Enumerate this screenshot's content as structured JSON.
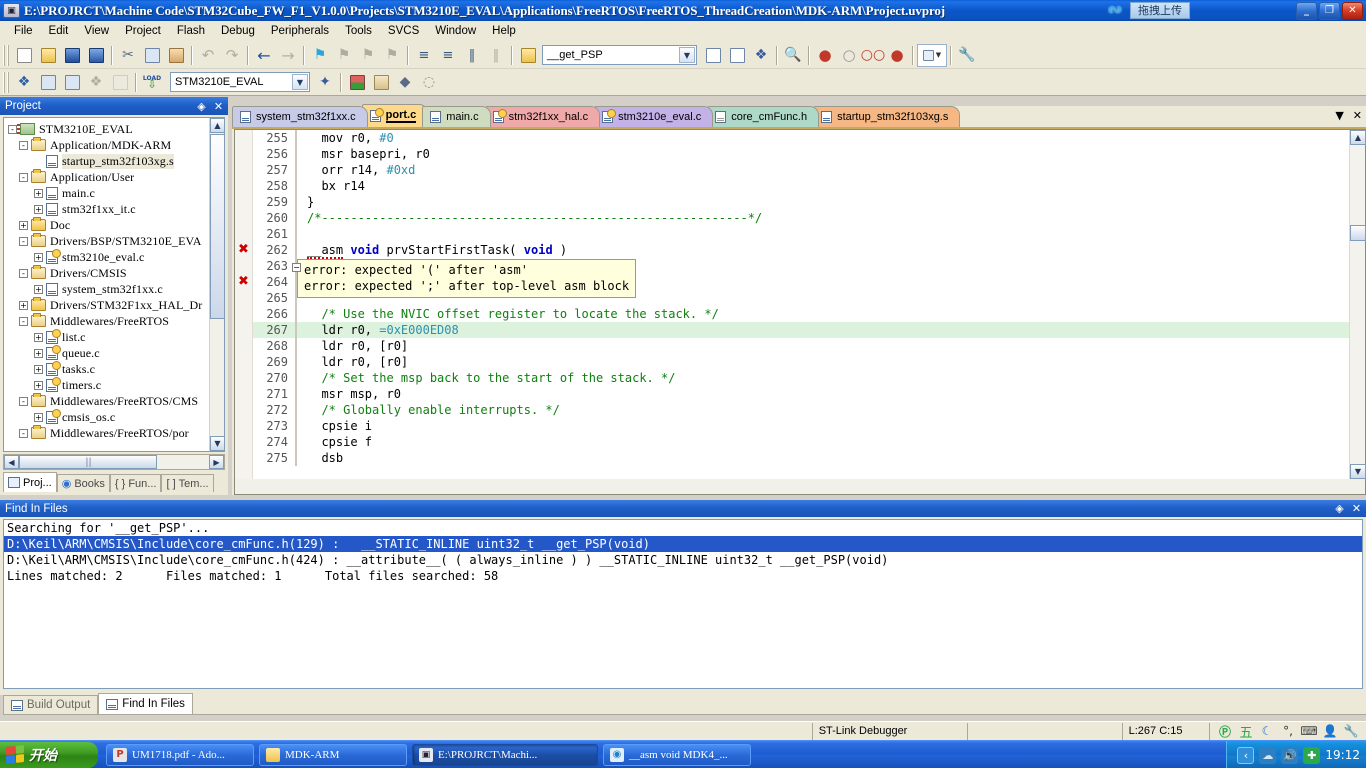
{
  "window": {
    "title": "E:\\PROJRCT\\Machine Code\\STM32Cube_FW_F1_V1.0.0\\Projects\\STM3210E_EVAL\\Applications\\FreeRTOS\\FreeRTOS_ThreadCreation\\MDK-ARM\\Project.uvproj",
    "minimize": "_",
    "maximize": "❐",
    "close": "✕",
    "upload_overlay_label": "拖拽上传"
  },
  "menu": [
    {
      "label": "File"
    },
    {
      "label": "Edit"
    },
    {
      "label": "View"
    },
    {
      "label": "Project"
    },
    {
      "label": "Flash"
    },
    {
      "label": "Debug"
    },
    {
      "label": "Peripherals"
    },
    {
      "label": "Tools"
    },
    {
      "label": "SVCS"
    },
    {
      "label": "Window"
    },
    {
      "label": "Help"
    }
  ],
  "toolbar1": {
    "icons": [
      "new-file-icon",
      "open-file-icon",
      "save-icon",
      "save-all-icon",
      "cut-icon",
      "copy-icon",
      "paste-icon",
      "undo-icon",
      "redo-icon",
      "back-icon",
      "forward-icon",
      "bookmark-toggle-icon",
      "bookmark-prev-icon",
      "bookmark-next-icon",
      "bookmark-clear-icon",
      "indent-icon",
      "outdent-icon",
      "comment-icon",
      "uncomment-icon",
      "open-folder-icon"
    ],
    "search_value": "__get_PSP",
    "search_placeholder": "",
    "right_icons": [
      "find-in-files-icon",
      "browse-icon",
      "bookmark-nav-icon",
      "find-icon",
      "insert-breakpoint-icon",
      "disable-breakpoint-icon",
      "disable-all-breakpoints-icon",
      "kill-all-breakpoints-icon",
      "project-window-icon",
      "configuration-icon"
    ]
  },
  "toolbar2": {
    "icons": [
      "translate-icon",
      "build-icon",
      "rebuild-icon",
      "batch-build-icon",
      "stop-build-icon",
      "download-icon"
    ],
    "target_value": "STM3210E_EVAL",
    "right_icons": [
      "target-options-icon",
      "manage-project-items-icon",
      "multi-project-icon",
      "components-icon",
      "packs-icon"
    ]
  },
  "project_panel": {
    "caption": "Project",
    "caption_buttons": [
      "multi-project-icon",
      "close-icon"
    ],
    "tree": [
      {
        "indent": 0,
        "toggle": "-",
        "icon": "target-icon",
        "label": "STM3210E_EVAL",
        "selected": false
      },
      {
        "indent": 1,
        "toggle": "-",
        "icon": "folder-open-icon",
        "label": "Application/MDK-ARM",
        "selected": false
      },
      {
        "indent": 2,
        "toggle": "",
        "icon": "asm-file-icon",
        "label": "startup_stm32f103xg.s",
        "selected": true
      },
      {
        "indent": 1,
        "toggle": "-",
        "icon": "folder-open-icon",
        "label": "Application/User",
        "selected": false
      },
      {
        "indent": 2,
        "toggle": "+",
        "icon": "c-file-icon",
        "label": "main.c",
        "selected": false
      },
      {
        "indent": 2,
        "toggle": "+",
        "icon": "c-file-icon",
        "label": "stm32f1xx_it.c",
        "selected": false
      },
      {
        "indent": 1,
        "toggle": "+",
        "icon": "folder-icon",
        "label": "Doc",
        "selected": false
      },
      {
        "indent": 1,
        "toggle": "-",
        "icon": "folder-open-icon",
        "label": "Drivers/BSP/STM3210E_EVA",
        "selected": false
      },
      {
        "indent": 2,
        "toggle": "+",
        "icon": "c-file-key-icon",
        "label": "stm3210e_eval.c",
        "selected": false
      },
      {
        "indent": 1,
        "toggle": "-",
        "icon": "folder-open-icon",
        "label": "Drivers/CMSIS",
        "selected": false
      },
      {
        "indent": 2,
        "toggle": "+",
        "icon": "c-file-icon",
        "label": "system_stm32f1xx.c",
        "selected": false
      },
      {
        "indent": 1,
        "toggle": "+",
        "icon": "folder-icon",
        "label": "Drivers/STM32F1xx_HAL_Dr",
        "selected": false
      },
      {
        "indent": 1,
        "toggle": "-",
        "icon": "folder-open-icon",
        "label": "Middlewares/FreeRTOS",
        "selected": false
      },
      {
        "indent": 2,
        "toggle": "+",
        "icon": "c-file-key-icon",
        "label": "list.c",
        "selected": false
      },
      {
        "indent": 2,
        "toggle": "+",
        "icon": "c-file-key-icon",
        "label": "queue.c",
        "selected": false
      },
      {
        "indent": 2,
        "toggle": "+",
        "icon": "c-file-key-icon",
        "label": "tasks.c",
        "selected": false
      },
      {
        "indent": 2,
        "toggle": "+",
        "icon": "c-file-key-icon",
        "label": "timers.c",
        "selected": false
      },
      {
        "indent": 1,
        "toggle": "-",
        "icon": "folder-open-icon",
        "label": "Middlewares/FreeRTOS/CMS",
        "selected": false
      },
      {
        "indent": 2,
        "toggle": "+",
        "icon": "c-file-key-icon",
        "label": "cmsis_os.c",
        "selected": false
      },
      {
        "indent": 1,
        "toggle": "-",
        "icon": "folder-open-icon",
        "label": "Middlewares/FreeRTOS/por",
        "selected": false
      }
    ],
    "tabs": [
      {
        "label": "Proj...",
        "icon": "project-icon",
        "active": true
      },
      {
        "label": "Books",
        "icon": "books-icon",
        "active": false
      },
      {
        "label": "Fun...",
        "icon": "functions-icon",
        "active": false
      },
      {
        "label": "Tem...",
        "icon": "templates-icon",
        "active": false
      }
    ]
  },
  "editor": {
    "tabs": [
      {
        "label": "system_stm32f1xx.c",
        "color": "#c8cbe8",
        "icon": "c-file-icon",
        "active": false
      },
      {
        "label": "port.c",
        "color": "#ffd98a",
        "icon": "c-file-key-icon",
        "active": true
      },
      {
        "label": "main.c",
        "color": "#cfdcc0",
        "icon": "c-file-icon",
        "active": false
      },
      {
        "label": "stm32f1xx_hal.c",
        "color": "#f0a9a9",
        "icon": "c-file-key-icon",
        "active": false
      },
      {
        "label": "stm3210e_eval.c",
        "color": "#c3b2e8",
        "icon": "c-file-key-icon",
        "active": false
      },
      {
        "label": "core_cmFunc.h",
        "color": "#aed9c8",
        "icon": "h-file-icon",
        "active": false
      },
      {
        "label": "startup_stm32f103xg.s",
        "color": "#f5b784",
        "icon": "asm-file-icon",
        "active": false
      }
    ],
    "nav": {
      "dropdown": "▼",
      "close": "✕"
    },
    "lines": [
      {
        "n": "255",
        "text": "  mov r0, #0",
        "error": false,
        "highlight": false
      },
      {
        "n": "256",
        "text": "  msr basepri, r0",
        "error": false,
        "highlight": false
      },
      {
        "n": "257",
        "text": "  orr r14, #0xd",
        "error": false,
        "highlight": false
      },
      {
        "n": "258",
        "text": "  bx r14",
        "error": false,
        "highlight": false
      },
      {
        "n": "259",
        "text": "}",
        "error": false,
        "highlight": false
      },
      {
        "n": "260",
        "text": "/*-----------------------------------------------------------*/",
        "error": false,
        "highlight": false
      },
      {
        "n": "261",
        "text": "",
        "error": false,
        "highlight": false
      },
      {
        "n": "262",
        "text": "__asm void prvStartFirstTask( void )",
        "error": true,
        "highlight": false
      },
      {
        "n": "263",
        "text": "{",
        "error": false,
        "highlight": false
      },
      {
        "n": "264",
        "text": "",
        "error": true,
        "highlight": false
      },
      {
        "n": "265",
        "text": "",
        "error": false,
        "highlight": false
      },
      {
        "n": "266",
        "text": "  /* Use the NVIC offset register to locate the stack. */",
        "error": false,
        "highlight": false
      },
      {
        "n": "267",
        "text": "  ldr r0, =0xE000ED08",
        "error": false,
        "highlight": true
      },
      {
        "n": "268",
        "text": "  ldr r0, [r0]",
        "error": false,
        "highlight": false
      },
      {
        "n": "269",
        "text": "  ldr r0, [r0]",
        "error": false,
        "highlight": false
      },
      {
        "n": "270",
        "text": "  /* Set the msp back to the start of the stack. */",
        "error": false,
        "highlight": false
      },
      {
        "n": "271",
        "text": "  msr msp, r0",
        "error": false,
        "highlight": false
      },
      {
        "n": "272",
        "text": "  /* Globally enable interrupts. */",
        "error": false,
        "highlight": false
      },
      {
        "n": "273",
        "text": "  cpsie i",
        "error": false,
        "highlight": false
      },
      {
        "n": "274",
        "text": "  cpsie f",
        "error": false,
        "highlight": false
      },
      {
        "n": "275",
        "text": "  dsb",
        "error": false,
        "highlight": false
      }
    ],
    "error_tooltip": [
      "error: expected '(' after 'asm'",
      "error: expected ';' after top-level asm block"
    ]
  },
  "find_in_files": {
    "caption": "Find In Files",
    "caption_buttons": [
      "restore-icon",
      "close-icon"
    ],
    "lines": [
      {
        "text": "Searching for '__get_PSP'...",
        "selected": false
      },
      {
        "text": "D:\\Keil\\ARM\\CMSIS\\Include\\core_cmFunc.h(129) :   __STATIC_INLINE uint32_t __get_PSP(void)",
        "selected": true
      },
      {
        "text": "D:\\Keil\\ARM\\CMSIS\\Include\\core_cmFunc.h(424) : __attribute__( ( always_inline ) ) __STATIC_INLINE uint32_t __get_PSP(void)",
        "selected": false
      },
      {
        "text": "Lines matched: 2      Files matched: 1      Total files searched: 58",
        "selected": false
      }
    ]
  },
  "output_tabs": [
    {
      "label": "Build Output",
      "icon": "build-output-icon",
      "active": false
    },
    {
      "label": "Find In Files",
      "icon": "find-in-files-icon",
      "active": true
    }
  ],
  "status_bar": {
    "message": "",
    "debugger": "ST-Link Debugger",
    "middle": "",
    "cursor": "L:267 C:15",
    "tray_icons": [
      "sogou-icon",
      "wubi-icon",
      "moon-icon",
      "punctuation-icon",
      "keyboard-icon",
      "user-icon",
      "wrench-icon"
    ]
  },
  "taskbar": {
    "start_label": "开始",
    "items": [
      {
        "label": "UM1718.pdf - Ado...",
        "icon": "pdf-icon",
        "active": false
      },
      {
        "label": "MDK-ARM",
        "icon": "folder-icon",
        "active": false
      },
      {
        "label": "E:\\PROJRCT\\Machi...",
        "icon": "uvision-icon",
        "active": true
      },
      {
        "label": "__asm void MDK4_...",
        "icon": "browser-icon",
        "active": false
      }
    ],
    "tray": {
      "show_hidden": "‹",
      "icons": [
        "network-icon",
        "volume-icon",
        "security-icon"
      ],
      "clock": "19:12"
    }
  },
  "colors": {
    "titlebar": "#0b56c8",
    "menubar": "#ece9d8",
    "accent": "#1f5fc8",
    "error": "#cc0000",
    "comment": "#108010",
    "number": "#2b91af",
    "keyword": "#0000c0",
    "highlight_line": "#ddf2dd",
    "tooltip_bg": "#ffffdd",
    "selection": "#2458c8"
  }
}
